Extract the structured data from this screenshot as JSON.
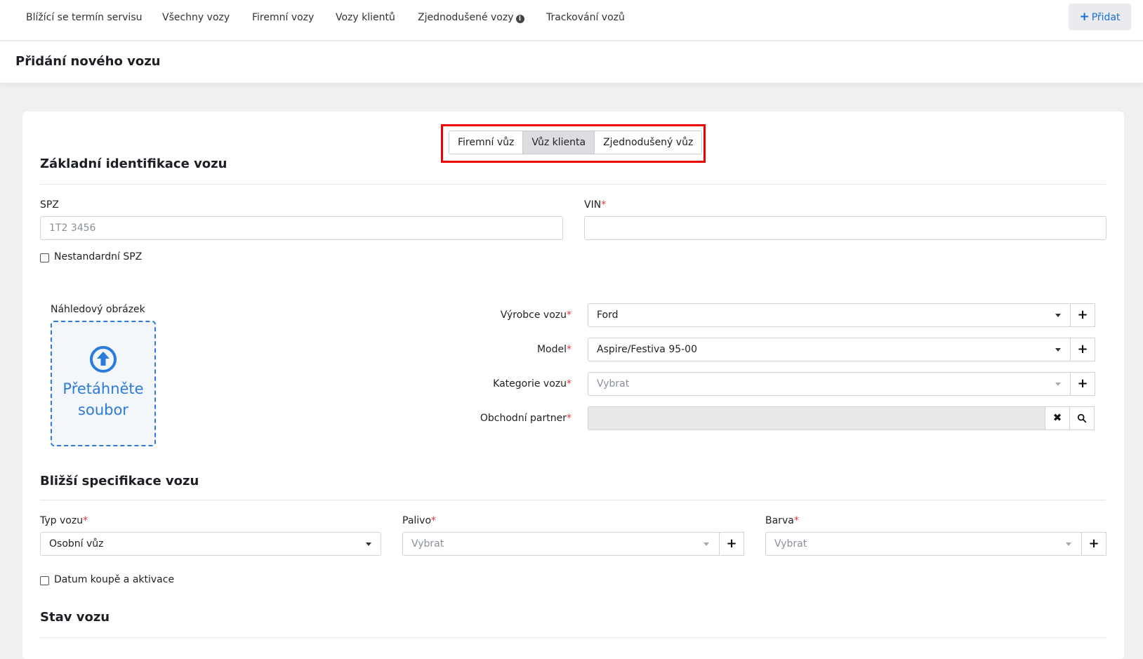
{
  "nav": {
    "items": [
      "Blížící se termín servisu",
      "Všechny vozy",
      "Firemní vozy",
      "Vozy klientů",
      "Zjednodušené vozy",
      "Trackování vozů"
    ],
    "add_label": "Přidat"
  },
  "page": {
    "title": "Přidání nového vozu"
  },
  "type_switch": {
    "options": [
      "Firemní vůz",
      "Vůz klienta",
      "Zjednodušený vůz"
    ],
    "selected": "Vůz klienta"
  },
  "basic": {
    "title": "Základní identifikace vozu",
    "spz": {
      "label": "SPZ",
      "placeholder": "1T2 3456",
      "value": ""
    },
    "vin": {
      "label": "VIN",
      "value": ""
    },
    "nonstandard_label": "Nestandardní SPZ",
    "preview_label": "Náhledový obrázek",
    "dropzone_text": [
      "Přetáhněte",
      "soubor"
    ],
    "manufacturer": {
      "label": "Výrobce vozu",
      "value": "Ford"
    },
    "model": {
      "label": "Model",
      "value": "Aspire/Festiva 95-00"
    },
    "category": {
      "label": "Kategorie vozu",
      "placeholder": "Vybrat"
    },
    "partner": {
      "label": "Obchodní partner",
      "value": ""
    }
  },
  "spec": {
    "title": "Bližší specifikace vozu",
    "type": {
      "label": "Typ vozu",
      "value": "Osobní vůz"
    },
    "fuel": {
      "label": "Palivo",
      "placeholder": "Vybrat"
    },
    "color": {
      "label": "Barva",
      "placeholder": "Vybrat"
    },
    "purchase_label": "Datum koupě a aktivace"
  },
  "state": {
    "title": "Stav vozu"
  },
  "colors": {
    "accent": "#2a7bdc",
    "required": "#e53935",
    "highlight": "#ee0000"
  }
}
